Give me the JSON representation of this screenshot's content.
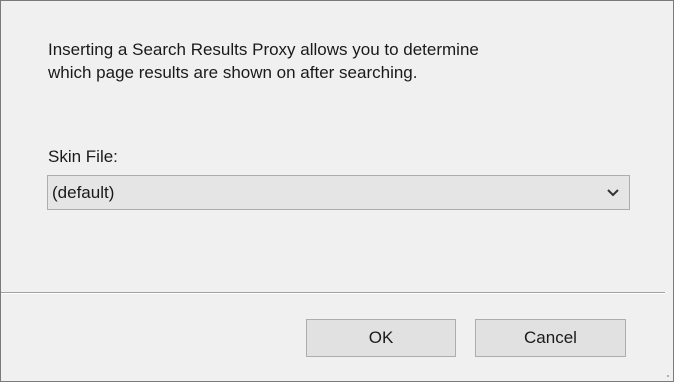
{
  "dialog": {
    "description_line1": "Inserting a Search Results Proxy allows you to determine",
    "description_line2": "which page results are shown on after searching.",
    "skin_file_label": "Skin File:",
    "skin_file_value": "(default)",
    "dropdown_icon": "chevron-down-icon"
  },
  "buttons": {
    "ok_label": "OK",
    "cancel_label": "Cancel"
  },
  "colors": {
    "dialog_background": "#f0f0f0",
    "button_background": "#e1e1e1",
    "button_border": "#adadad",
    "select_background": "#e5e5e5"
  }
}
